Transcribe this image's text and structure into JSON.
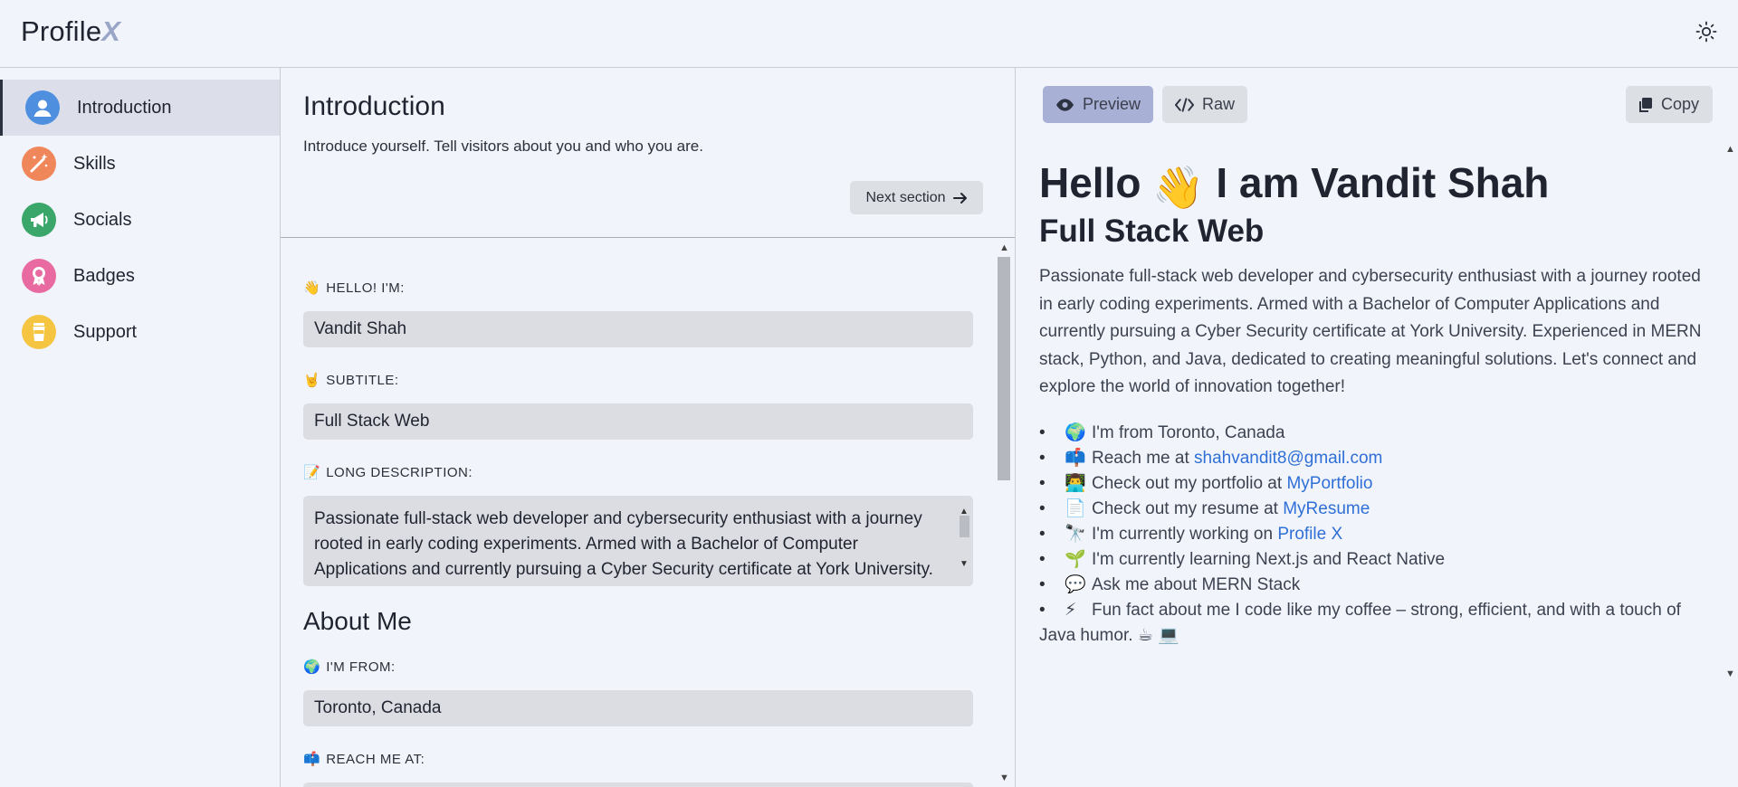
{
  "app": {
    "logo_main": "Profile",
    "logo_accent": "X"
  },
  "sidebar": {
    "items": [
      {
        "label": "Introduction",
        "icon": "user-icon",
        "color": "#4f8fe0",
        "active": true
      },
      {
        "label": "Skills",
        "icon": "magic-wand-icon",
        "color": "#f0875a"
      },
      {
        "label": "Socials",
        "icon": "megaphone-icon",
        "color": "#3aa66a"
      },
      {
        "label": "Badges",
        "icon": "award-icon",
        "color": "#e86aa0"
      },
      {
        "label": "Support",
        "icon": "coffee-cup-icon",
        "color": "#f5c542"
      }
    ]
  },
  "editor": {
    "title": "Introduction",
    "description": "Introduce yourself. Tell visitors about you and who you are.",
    "next_label": "Next section",
    "fields": {
      "hello": {
        "emoji": "👋",
        "label": "HELLO! I'M:",
        "value": "Vandit Shah"
      },
      "subtitle": {
        "emoji": "🤘",
        "label": "SUBTITLE:",
        "value": "Full Stack Web"
      },
      "long_desc": {
        "emoji": "📝",
        "label": "LONG DESCRIPTION:",
        "value": "Passionate full-stack web developer and cybersecurity enthusiast with a journey rooted in early coding experiments. Armed with a Bachelor of Computer Applications and currently pursuing a Cyber Security certificate at York University."
      },
      "about_title": "About Me",
      "from": {
        "emoji": "🌍",
        "label": "I'M FROM:",
        "value": "Toronto, Canada"
      },
      "reach": {
        "emoji": "📫",
        "label": "REACH ME AT:"
      }
    }
  },
  "preview": {
    "tabs": {
      "preview": "Preview",
      "raw": "Raw",
      "copy": "Copy"
    },
    "h1_prefix": "Hello",
    "h1_emoji": "👋",
    "h1_suffix": "I am Vandit Shah",
    "h2": "Full Stack Web",
    "paragraph": "Passionate full-stack web developer and cybersecurity enthusiast with a journey rooted in early coding experiments. Armed with a Bachelor of Computer Applications and currently pursuing a Cyber Security certificate at York University. Experienced in MERN stack, Python, and Java, dedicated to creating meaningful solutions. Let's connect and explore the world of innovation together!",
    "list": [
      {
        "emoji": "🌍",
        "text": "I'm from Toronto, Canada",
        "link": ""
      },
      {
        "emoji": "📫",
        "text": "Reach me at ",
        "link": "shahvandit8@gmail.com"
      },
      {
        "emoji": "👨‍💻",
        "text": "Check out my portfolio at ",
        "link": "MyPortfolio"
      },
      {
        "emoji": "📄",
        "text": "Check out my resume at ",
        "link": "MyResume"
      },
      {
        "emoji": "🔭",
        "text": "I'm currently working on ",
        "link": "Profile X"
      },
      {
        "emoji": "🌱",
        "text": "I'm currently learning Next.js and React Native",
        "link": ""
      },
      {
        "emoji": "💬",
        "text": "Ask me about MERN Stack",
        "link": ""
      },
      {
        "emoji": "⚡",
        "text": "Fun fact about me I code like my coffee – strong, efficient, and with a touch of Java humor. ☕ 💻",
        "link": ""
      }
    ]
  }
}
